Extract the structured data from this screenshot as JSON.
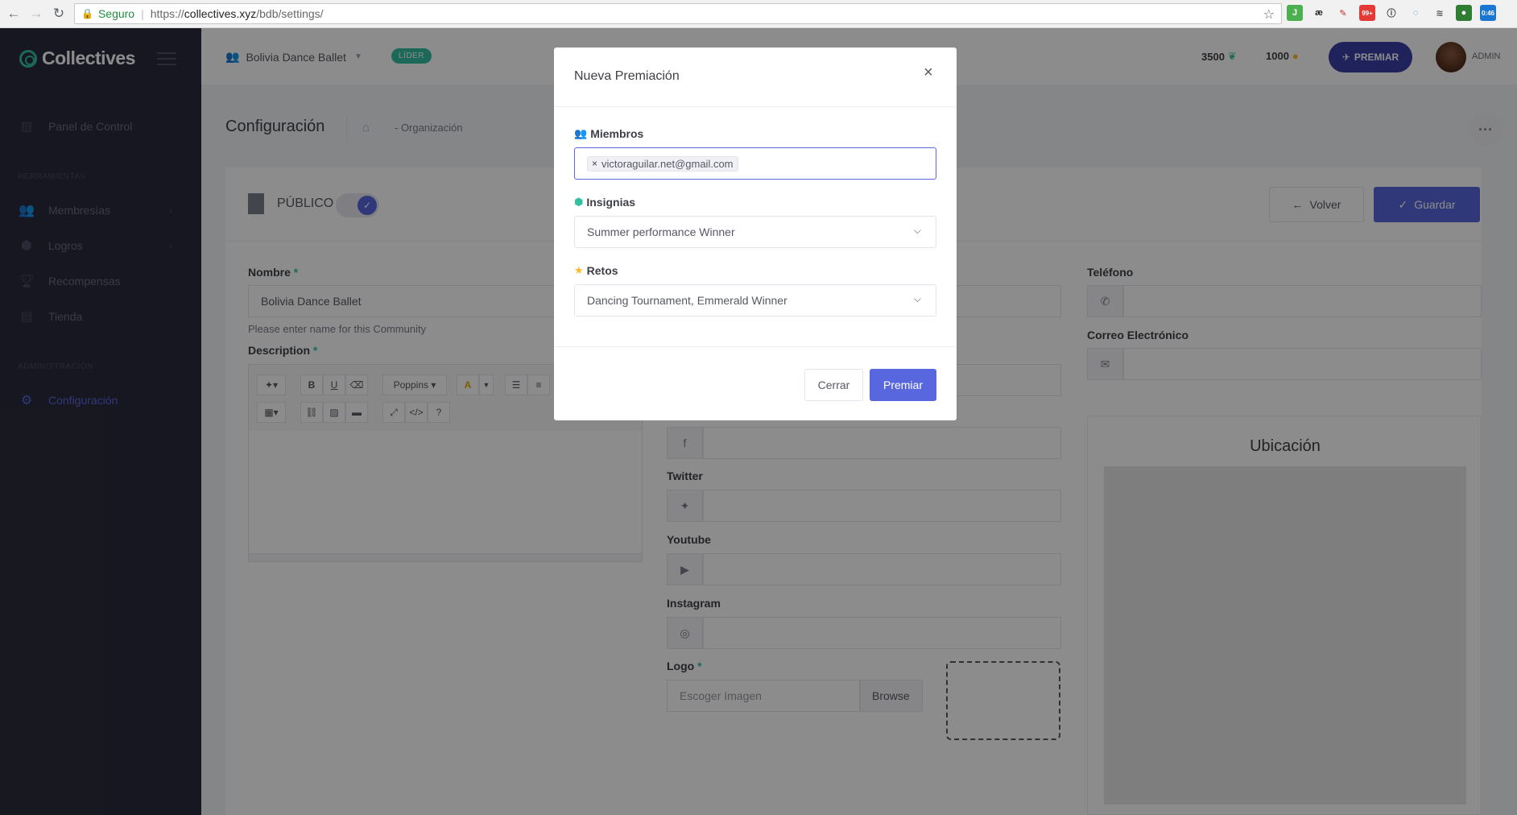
{
  "browser": {
    "secure_label": "Seguro",
    "url_prefix": "https://",
    "url_host": "collectives.xyz",
    "url_path": "/bdb/settings/",
    "ext_badges": [
      "99+",
      "0:46"
    ]
  },
  "sidebar": {
    "brand": "Collectives",
    "sections": [
      "HERRAMIENTAS",
      "ADMINISTRACIÓN"
    ],
    "items": [
      {
        "label": "Panel de Control",
        "icon": "bar-chart-icon"
      },
      {
        "label": "Membresías",
        "icon": "users-icon"
      },
      {
        "label": "Logros",
        "icon": "cube-icon"
      },
      {
        "label": "Recompensas",
        "icon": "trophy-icon"
      },
      {
        "label": "Tienda",
        "icon": "store-icon"
      },
      {
        "label": "Configuración",
        "icon": "gears-icon"
      }
    ],
    "caret": "›"
  },
  "header": {
    "org_name": "Bolivia Dance Ballet",
    "role_badge": "LÍDER",
    "points_leaf": "3500",
    "points_coins": "1000",
    "premiar_label": "PREMIAR",
    "user_label": "ADMIN"
  },
  "subheader": {
    "title": "Configuración",
    "breadcrumb": "- Organización"
  },
  "card": {
    "public_label": "PÚBLICO",
    "back_label": "Volver",
    "save_label": "Guardar"
  },
  "form": {
    "nombre_label": "Nombre",
    "nombre_value": "Bolivia Dance Ballet",
    "nombre_help": "Please enter name for this Community",
    "description_label": "Description",
    "font_dropdown": "Poppins",
    "twitter_label": "Twitter",
    "youtube_label": "Youtube",
    "instagram_label": "Instagram",
    "logo_label": "Logo",
    "logo_placeholder": "Escoger Imagen",
    "browse_label": "Browse",
    "telefono_label": "Teléfono",
    "correo_label": "Correo Electrónico",
    "ubicacion_title": "Ubicación",
    "required_mark": "*"
  },
  "modal": {
    "title": "Nueva Premiación",
    "close_symbol": "×",
    "miembros_label": "Miembros",
    "member_tag": "victoraguilar.net@gmail.com",
    "insignias_label": "Insignias",
    "insignias_value": "Summer performance Winner",
    "retos_label": "Retos",
    "retos_value": "Dancing Tournament, Emmerald Winner",
    "cancel_label": "Cerrar",
    "submit_label": "Premiar"
  },
  "colors": {
    "accent": "#5867dd",
    "success": "#34bfa3",
    "sidebar_bg": "#2b2b3d",
    "premiar_btn": "#3b3fa8"
  }
}
